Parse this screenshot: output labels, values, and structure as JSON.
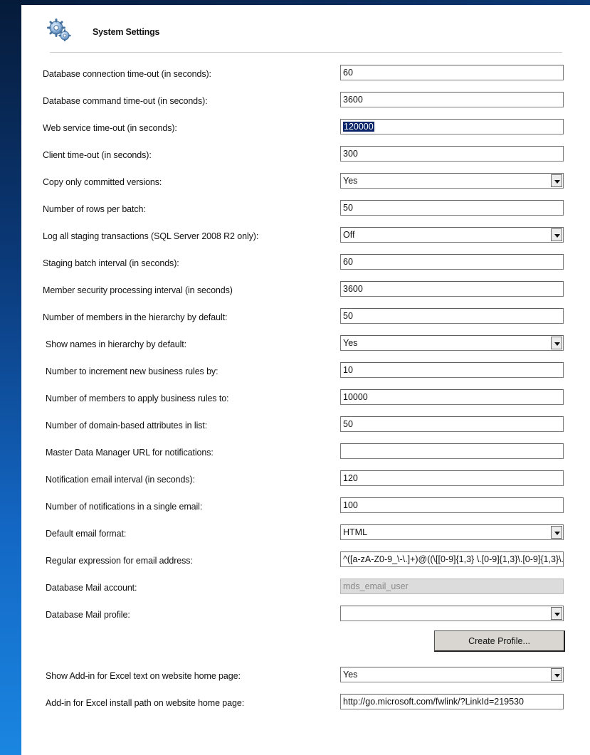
{
  "header": {
    "title": "System Settings",
    "icon": "gears-icon"
  },
  "settings": [
    {
      "label": "Database connection time-out (in seconds):",
      "type": "text",
      "value": "60"
    },
    {
      "label": "Database command time-out (in seconds):",
      "type": "text",
      "value": "3600"
    },
    {
      "label": "Web service time-out (in seconds):",
      "type": "text",
      "value": "120000",
      "selected": true
    },
    {
      "label": "Client time-out (in seconds):",
      "type": "text",
      "value": "300"
    },
    {
      "label": "Copy only committed versions:",
      "type": "select",
      "value": "Yes"
    },
    {
      "label": "Number of rows per batch:",
      "type": "text",
      "value": "50"
    },
    {
      "label": "Log all staging transactions (SQL Server 2008 R2 only):",
      "type": "select",
      "value": "Off"
    },
    {
      "label": "Staging batch interval (in seconds):",
      "type": "text",
      "value": "60"
    },
    {
      "label": "Member security processing interval (in seconds)",
      "type": "text",
      "value": "3600"
    },
    {
      "label": "Number of members in the hierarchy by default:",
      "type": "text",
      "value": "50"
    },
    {
      "label": "Show names in hierarchy by default:",
      "type": "select",
      "value": "Yes"
    },
    {
      "label": "Number to increment new business rules by:",
      "type": "text",
      "value": "10"
    },
    {
      "label": "Number of members to apply business rules to:",
      "type": "text",
      "value": "10000"
    },
    {
      "label": "Number of domain-based attributes in list:",
      "type": "text",
      "value": "50"
    },
    {
      "label": "Master Data Manager URL for notifications:",
      "type": "text",
      "value": ""
    },
    {
      "label": "Notification email interval (in seconds):",
      "type": "text",
      "value": "120"
    },
    {
      "label": "Number of notifications in a single email:",
      "type": "text",
      "value": "100"
    },
    {
      "label": "Default email format:",
      "type": "select",
      "value": "HTML"
    },
    {
      "label": "Regular expression for email address:",
      "type": "text",
      "value": "^([a-zA-Z0-9_\\-\\.]+)@((\\[[0-9]{1,3} \\.[0-9]{1,3}\\.[0-9]{1,3}\\."
    },
    {
      "label": "Database Mail account:",
      "type": "text",
      "value": "mds_email_user",
      "disabled": true
    },
    {
      "label": "Database Mail profile:",
      "type": "select",
      "value": ""
    },
    {
      "label": "Show Add-in for Excel text on website home page:",
      "type": "select",
      "value": "Yes"
    },
    {
      "label": "Add-in for Excel install path on website home page:",
      "type": "text",
      "value": "http://go.microsoft.com/fwlink/?LinkId=219530"
    }
  ],
  "buttons": {
    "create_profile": "Create Profile..."
  }
}
